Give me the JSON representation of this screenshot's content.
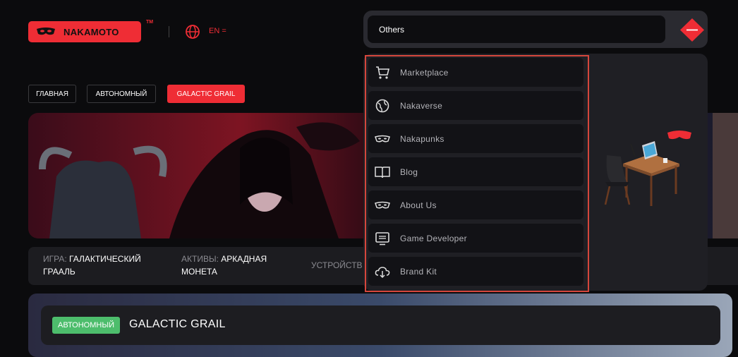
{
  "header": {
    "logo_text": "NAKAMOTO",
    "trademark": "TM",
    "language": "EN ="
  },
  "breadcrumbs": [
    {
      "label": "ГЛАВНАЯ"
    },
    {
      "label": "АВТОНОМНЫЙ"
    },
    {
      "label": "GALACTIC GRAIL",
      "active": true
    }
  ],
  "info": {
    "game_key": "ИГРА:",
    "game_val": "ГАЛАКТИЧЕСКИЙ",
    "game_val2": "ГРААЛЬ",
    "assets_key": "АКТИВЫ:",
    "assets_val": "АРКАДНАЯ",
    "assets_val2": "МОНЕТА",
    "device_key": "УСТРОЙСТВ"
  },
  "card": {
    "badge": "АВТОНОМНЫЙ",
    "title": "GALACTIC GRAIL"
  },
  "dropdown": {
    "selected": "Others",
    "items": [
      {
        "label": "Marketplace",
        "icon": "cart-icon"
      },
      {
        "label": "Nakaverse",
        "icon": "globe-icon"
      },
      {
        "label": "Nakapunks",
        "icon": "mask-icon"
      },
      {
        "label": "Blog",
        "icon": "book-icon"
      },
      {
        "label": "About Us",
        "icon": "mask-icon"
      },
      {
        "label": "Game Developer",
        "icon": "monitor-icon"
      },
      {
        "label": "Brand Kit",
        "icon": "cloud-download-icon"
      }
    ]
  },
  "colors": {
    "accent": "#ef2d35",
    "badge_green": "#4dbd6c",
    "panel": "#1f1f24",
    "highlight_frame": "#d5463c"
  }
}
